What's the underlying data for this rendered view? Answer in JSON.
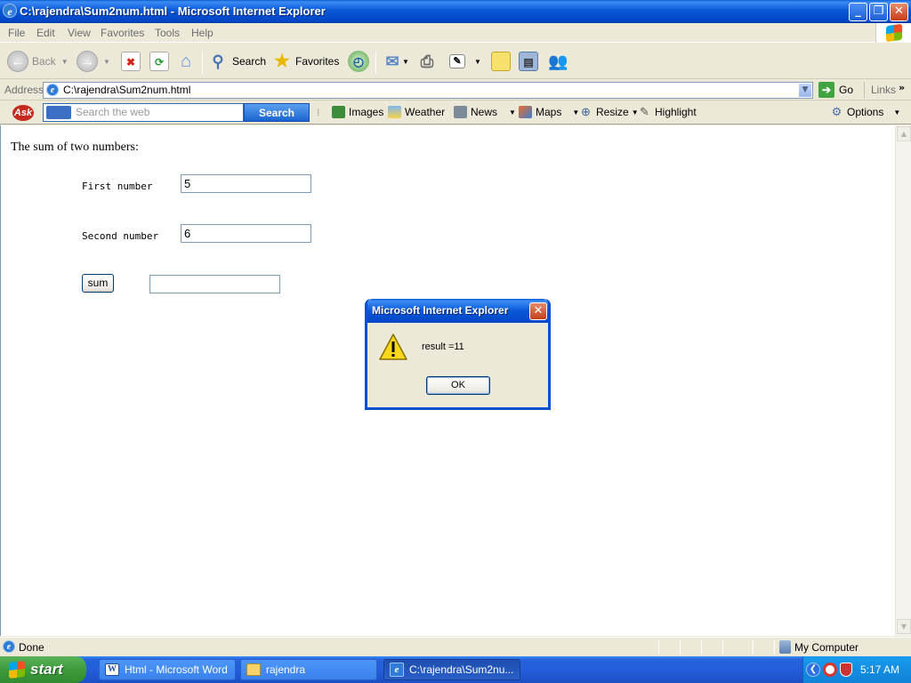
{
  "window": {
    "title": "C:\\rajendra\\Sum2num.html - Microsoft Internet Explorer"
  },
  "menu": [
    "File",
    "Edit",
    "View",
    "Favorites",
    "Tools",
    "Help"
  ],
  "toolbar": {
    "back": "Back",
    "search": "Search",
    "favorites": "Favorites"
  },
  "address": {
    "label": "Address",
    "url": "C:\\rajendra\\Sum2num.html",
    "go": "Go",
    "links": "Links"
  },
  "askbar": {
    "search_placeholder": "Search the web",
    "search_button": "Search",
    "items": [
      "Images",
      "Weather",
      "News",
      "Maps",
      "Resize",
      "Highlight"
    ],
    "options": "Options"
  },
  "page": {
    "heading": "The sum of two numbers:",
    "first_label": "First number",
    "first_value": "5",
    "second_label": "Second number",
    "second_value": "6",
    "sum_button": "sum",
    "result_value": ""
  },
  "dialog": {
    "title": "Microsoft Internet Explorer",
    "message": "result =11",
    "ok": "OK"
  },
  "status": {
    "text": "Done",
    "zone": "My Computer"
  },
  "taskbar": {
    "start": "start",
    "tasks": [
      "Html - Microsoft Word",
      "rajendra",
      "C:\\rajendra\\Sum2nu..."
    ],
    "clock": "5:17 AM"
  },
  "colors": {
    "xp_blue": "#0A5FD8",
    "start_green": "#3C9B3C",
    "warning_yellow": "#F9D71C"
  }
}
